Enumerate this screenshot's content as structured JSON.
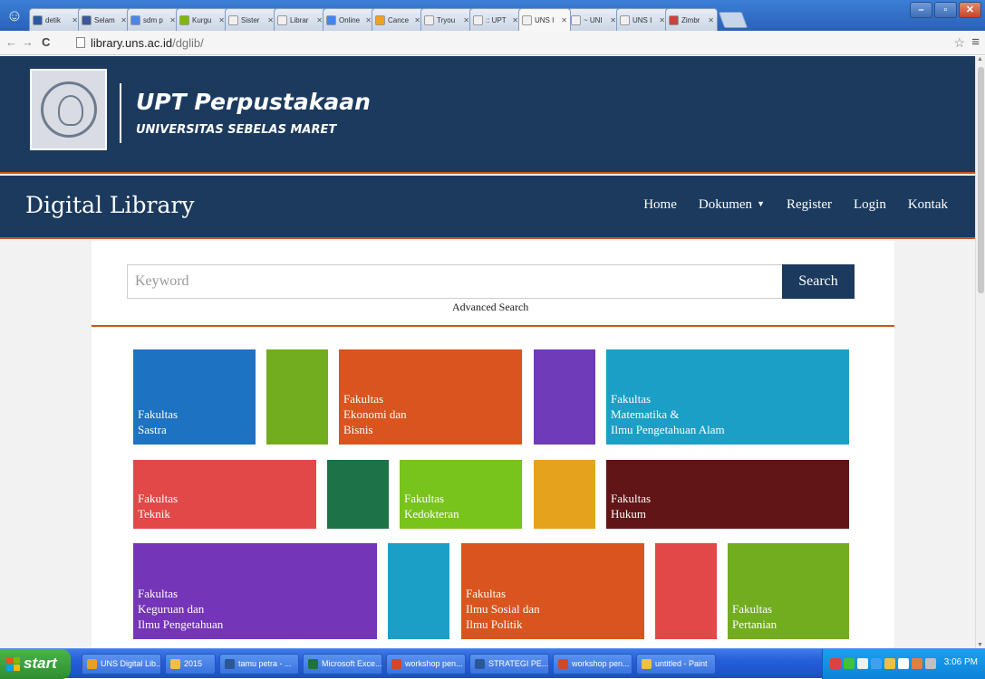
{
  "browser": {
    "tabs": [
      {
        "label": "detik",
        "color": "#2c5aa0"
      },
      {
        "label": "Selam",
        "color": "#3b5998"
      },
      {
        "label": "sdm p",
        "color": "#4a86e8"
      },
      {
        "label": "Kurgu",
        "color": "#7fb800"
      },
      {
        "label": "Sister",
        "color": "#f0f0f0"
      },
      {
        "label": "Librar",
        "color": "#f0f0f0"
      },
      {
        "label": "Online",
        "color": "#4285f4"
      },
      {
        "label": "Cance",
        "color": "#f0a020"
      },
      {
        "label": "Tryou",
        "color": "#f0f0f0"
      },
      {
        "label": ":: UPT",
        "color": "#f0f0f0"
      },
      {
        "label": "UNS I",
        "color": "#f0f0f0"
      },
      {
        "label": "~ UNI",
        "color": "#f0f0f0"
      },
      {
        "label": "UNS I",
        "color": "#f0f0f0"
      },
      {
        "label": "Zimbr",
        "color": "#d04040"
      }
    ],
    "active_tab_index": 10,
    "url_host": "library.uns.ac.id",
    "url_path": "/dglib/"
  },
  "header": {
    "title": "UPT Perpustakaan",
    "subtitle": "UNIVERSITAS SEBELAS MARET"
  },
  "navbar": {
    "brand": "Digital Library",
    "links": [
      "Home",
      "Dokumen",
      "Register",
      "Login",
      "Kontak"
    ]
  },
  "search": {
    "placeholder": "Keyword",
    "button": "Search",
    "advanced": "Advanced Search"
  },
  "tiles": [
    {
      "text": "Fakultas\nSastra",
      "color": "#1e72c2"
    },
    {
      "text": "",
      "color": "#72ad1f"
    },
    {
      "text": "Fakultas\nEkonomi dan\nBisnis",
      "color": "#d9541e"
    },
    {
      "text": "",
      "color": "#6f3bb8"
    },
    {
      "text": "Fakultas\nMatematika &\nIlmu Pengetahuan Alam",
      "color": "#1b9fc6"
    },
    {
      "text": "Fakultas\nTeknik",
      "color": "#e24848"
    },
    {
      "text": "",
      "color": "#1e7248"
    },
    {
      "text": "Fakultas\nKedokteran",
      "color": "#78c31c"
    },
    {
      "text": "",
      "color": "#e5a21c"
    },
    {
      "text": "Fakultas\nHukum",
      "color": "#621516"
    },
    {
      "text": "Fakultas\nKeguruan dan\nIlmu Pengetahuan",
      "color": "#7535b8"
    },
    {
      "text": "",
      "color": "#1b9fc6"
    },
    {
      "text": "Fakultas\nIlmu Sosial dan\nIlmu Politik",
      "color": "#d9541e"
    },
    {
      "text": "",
      "color": "#e24848"
    },
    {
      "text": "Fakultas\nPertanian",
      "color": "#72ad1f"
    },
    {
      "text": "",
      "color": "#e24848"
    },
    {
      "text": "",
      "color": "#1e72c2"
    },
    {
      "text": "",
      "color": "#d9541e"
    },
    {
      "text": "",
      "color": "#1e7248"
    },
    {
      "text": "",
      "color": "#621516"
    }
  ],
  "taskbar": {
    "start": "start",
    "items": [
      {
        "label": "UNS Digital Lib...",
        "color": "#e8a020"
      },
      {
        "label": "2015",
        "color": "#f0c040"
      },
      {
        "label": "tamu petra - ...",
        "color": "#2b5797"
      },
      {
        "label": "Microsoft Exce...",
        "color": "#1e7145"
      },
      {
        "label": "workshop pen...",
        "color": "#d24726"
      },
      {
        "label": "STRATEGI PE...",
        "color": "#2b5797"
      },
      {
        "label": "workshop pen...",
        "color": "#d24726"
      },
      {
        "label": "untitled - Paint",
        "color": "#f0c040"
      }
    ],
    "clock": "3:06 PM"
  }
}
